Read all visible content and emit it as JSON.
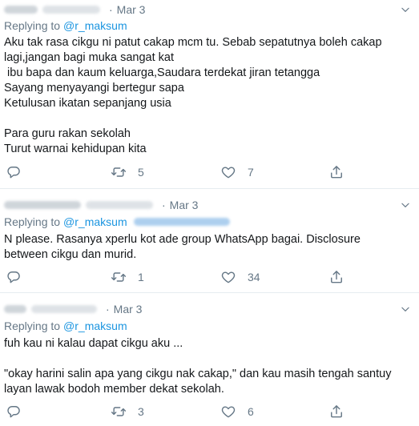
{
  "tweets": [
    {
      "date": "Mar 3",
      "replying_prefix": "Replying to",
      "mention": "@r_maksum",
      "body_lines": [
        "Aku tak rasa cikgu ni patut cakap mcm tu. Sebab sepatutnya boleh cakap",
        "lagi,jangan bagi muka sangat kat",
        " ibu bapa dan kaum keluarga,Saudara terdekat jiran tetangga",
        "Sayang menyayangi bertegur sapa",
        "Ketulusan ikatan sepanjang usia",
        "",
        "Para guru rakan sekolah",
        "Turut warnai kehidupan kita"
      ],
      "retweets": "5",
      "likes": "7"
    },
    {
      "date": "Mar 3",
      "replying_prefix": "Replying to",
      "mention": "@r_maksum",
      "body_lines": [
        "N please. Rasanya xperlu kot ade group WhatsApp bagai. Disclosure",
        "between cikgu dan murid."
      ],
      "retweets": "1",
      "likes": "34"
    },
    {
      "date": "Mar 3",
      "replying_prefix": "Replying to",
      "mention": "@r_maksum",
      "body_lines": [
        "fuh kau ni kalau dapat cikgu aku ...",
        "",
        "\"okay harini salin apa yang cikgu nak cakap,\" dan kau masih tengah santuy",
        "layan lawak bodoh member dekat sekolah."
      ],
      "retweets": "3",
      "likes": "6"
    }
  ],
  "icons": {
    "reply": "reply-icon",
    "retweet": "retweet-icon",
    "like": "like-icon",
    "share": "share-icon",
    "more": "chevron-down-icon"
  },
  "colors": {
    "muted": "#657786",
    "link": "#1b95e0",
    "divider": "#e6ecf0"
  }
}
